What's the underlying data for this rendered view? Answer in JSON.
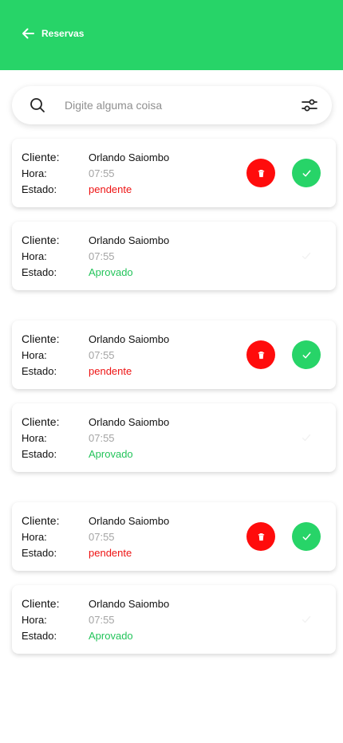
{
  "header": {
    "back_icon": "arrow-left-icon",
    "title": "Reservas",
    "color": "#27d468"
  },
  "search": {
    "placeholder": "Digite alguma coisa",
    "value": "",
    "search_icon": "search-icon",
    "filter_icon": "sliders-icon"
  },
  "labels": {
    "client": "Cliente:",
    "time": "Hora:",
    "status": "Estado:"
  },
  "reservations": [
    {
      "client": "Orlando Saiombo",
      "time": "07:55",
      "status": "pendente",
      "actions": [
        "delete",
        "approve"
      ]
    },
    {
      "client": "Orlando Saiombo",
      "time": "07:55",
      "status": "Aprovado",
      "actions": []
    },
    {
      "client": "Orlando Saiombo",
      "time": "07:55",
      "status": "pendente",
      "actions": [
        "delete",
        "approve"
      ]
    },
    {
      "client": "Orlando Saiombo",
      "time": "07:55",
      "status": "Aprovado",
      "actions": []
    },
    {
      "client": "Orlando Saiombo",
      "time": "07:55",
      "status": "pendente",
      "actions": [
        "delete",
        "approve"
      ]
    },
    {
      "client": "Orlando Saiombo",
      "time": "07:55",
      "status": "Aprovado",
      "actions": []
    }
  ],
  "colors": {
    "pending": "#ee1313",
    "approved": "#24c45b",
    "delete_button": "#ff0c0c",
    "approve_button": "#27d468"
  }
}
